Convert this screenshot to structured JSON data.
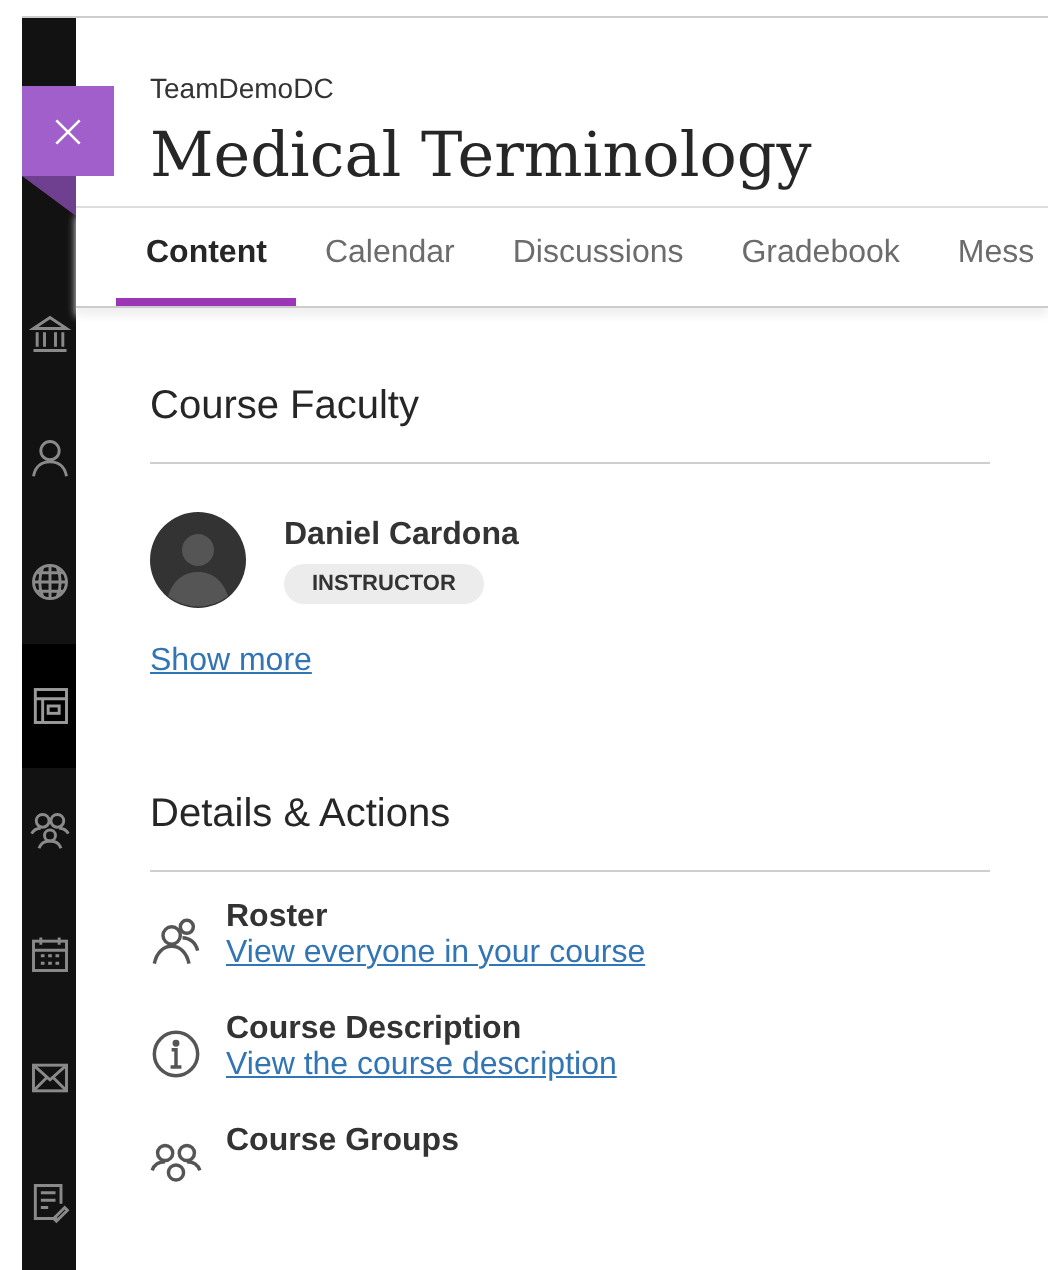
{
  "header": {
    "organization": "TeamDemoDC",
    "title": "Medical Terminology"
  },
  "tabs": [
    {
      "label": "Content",
      "selected": true
    },
    {
      "label": "Calendar",
      "selected": false
    },
    {
      "label": "Discussions",
      "selected": false
    },
    {
      "label": "Gradebook",
      "selected": false
    },
    {
      "label": "Mess",
      "selected": false
    }
  ],
  "sidebar": {
    "items": [
      {
        "kind": "institution",
        "selected": false
      },
      {
        "kind": "person",
        "selected": false
      },
      {
        "kind": "globe",
        "selected": false
      },
      {
        "kind": "course",
        "selected": true
      },
      {
        "kind": "groups",
        "selected": false
      },
      {
        "kind": "calendar",
        "selected": false
      },
      {
        "kind": "mail",
        "selected": false
      },
      {
        "kind": "grades",
        "selected": false
      }
    ]
  },
  "faculty": {
    "heading": "Course Faculty",
    "members": [
      {
        "name": "Daniel Cardona",
        "role": "INSTRUCTOR"
      }
    ],
    "show_more": "Show more"
  },
  "details": {
    "heading": "Details & Actions",
    "items": [
      {
        "kind": "roster",
        "title": "Roster",
        "link": "View everyone in your course"
      },
      {
        "kind": "info",
        "title": "Course Description",
        "link": "View the course description"
      },
      {
        "kind": "groups",
        "title": "Course Groups"
      }
    ]
  }
}
